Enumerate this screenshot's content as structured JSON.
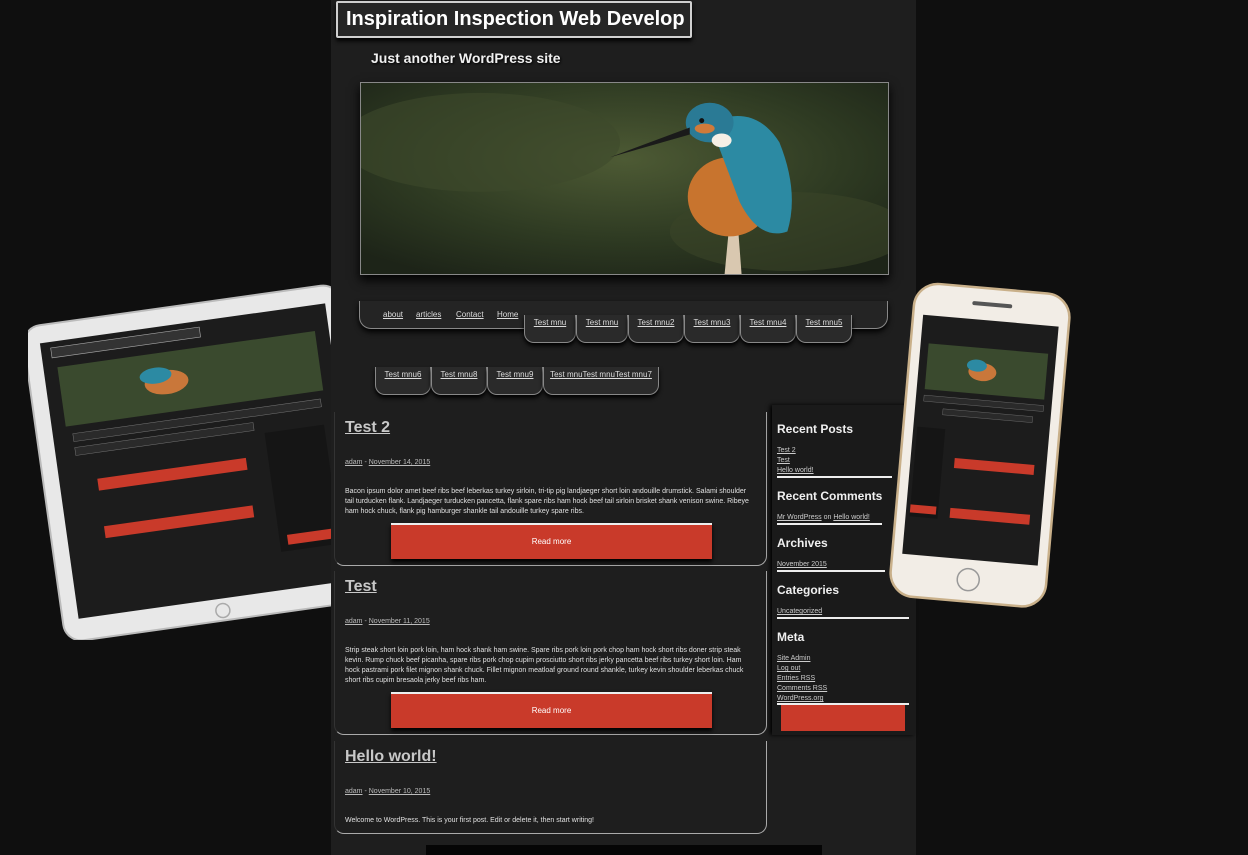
{
  "site": {
    "title": "Inspiration Inspection Web Develop",
    "tagline": "Just another WordPress site"
  },
  "menu": {
    "top_items": [
      "about",
      "articles",
      "Contact",
      "Home"
    ],
    "tabs_row1": [
      "Test mnu",
      "Test mnu",
      "Test mnu2",
      "Test mnu3",
      "Test mnu4",
      "Test mnu5"
    ],
    "tabs_row2": [
      "Test mnu6",
      "Test mnu8",
      "Test mnu9",
      "Test mnuTest mnuTest mnu7"
    ]
  },
  "posts": [
    {
      "title": "Test 2",
      "author": "adam",
      "date": "November 14, 2015",
      "body_visible": "Bacon ipsum dolor amet beef ribs beef leberkas turkey sirloin, tri-tip pig landjaeger short loin andouille drumstick. Salami shoulder tail turducken flank. Landjaeger turducken pancetta, flank spare ribs ham hock beef tail sirloin brisket shank venison swine. Ribeye ham hock chuck, flank pig hamburger shankle tail andouille turkey spare ribs.",
      "read_more": "Read more"
    },
    {
      "title": "Test",
      "author": "adam",
      "date": "November 11, 2015",
      "body_visible": "Strip steak short loin pork loin, ham hock shank ham swine. Spare ribs pork loin pork chop ham hock short ribs doner strip steak kevin. Rump chuck beef picanha, spare ribs pork chop cupim prosciutto short ribs jerky pancetta beef ribs turkey short loin. Ham hock pastrami pork filet mignon shank chuck. Fillet mignon meatloaf ground round shankle, turkey kevin shoulder leberkas chuck short ribs cupim bresaola jerky beef ribs ham.",
      "read_more": "Read more"
    },
    {
      "title": "Hello world!",
      "author": "adam",
      "date": "November 10, 2015",
      "body_visible": "Welcome to WordPress. This is your first post. Edit or delete it, then start writing!"
    }
  ],
  "sidebar": {
    "recent_posts": {
      "heading": "Recent Posts",
      "items": [
        "Test 2",
        "Test",
        "Hello world!"
      ]
    },
    "recent_comments": {
      "heading": "Recent Comments",
      "author": "Mr WordPress",
      "on": "on",
      "post": "Hello world!"
    },
    "archives": {
      "heading": "Archives",
      "items": [
        "November 2015"
      ]
    },
    "categories": {
      "heading": "Categories",
      "items": [
        "Uncategorized"
      ]
    },
    "meta": {
      "heading": "Meta",
      "items": [
        "Site Admin",
        "Log out",
        "Entries RSS",
        "Comments RSS",
        "WordPress.org"
      ]
    }
  },
  "colors": {
    "background": "#0f0f0f",
    "page": "#1e1e1e",
    "accent_red": "#c93a2a"
  },
  "icons": [
    "tablet-mockup",
    "phone-mockup",
    "kingfisher-photo"
  ]
}
